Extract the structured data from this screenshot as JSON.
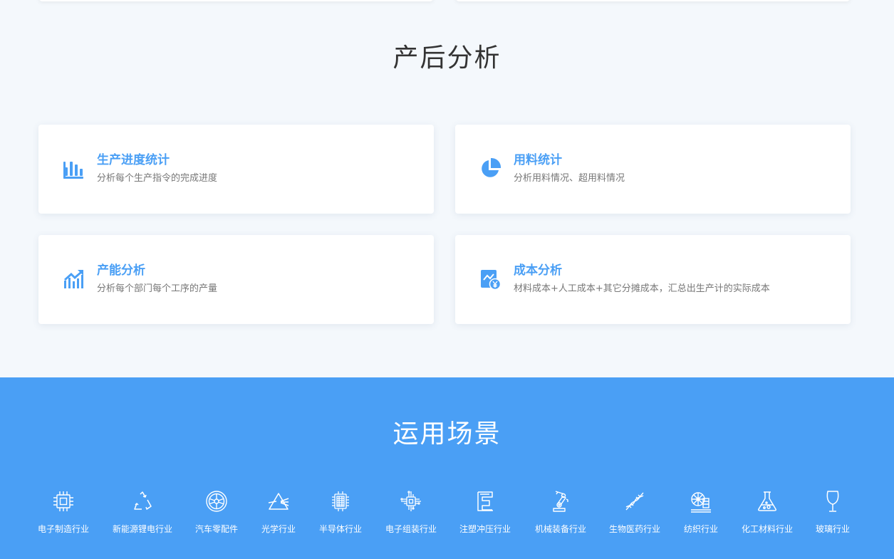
{
  "post_analysis": {
    "title": "产后分析",
    "cards": [
      {
        "title": "生产进度统计",
        "desc": "分析每个生产指令的完成进度",
        "icon": "bar-chart-icon"
      },
      {
        "title": "用料统计",
        "desc": "分析用料情况、超用料情况",
        "icon": "pie-chart-icon"
      },
      {
        "title": "产能分析",
        "desc": "分析每个部门每个工序的产量",
        "icon": "trend-chart-icon"
      },
      {
        "title": "成本分析",
        "desc": "材料成本+人工成本+其它分摊成本，汇总出生产计的实际成本",
        "icon": "cost-report-icon"
      }
    ]
  },
  "scenarios": {
    "title": "运用场景",
    "items": [
      {
        "label": "电子制造行业",
        "icon": "chip-icon"
      },
      {
        "label": "新能源锂电行业",
        "icon": "recycle-icon"
      },
      {
        "label": "汽车零配件",
        "icon": "wheel-icon"
      },
      {
        "label": "光学行业",
        "icon": "prism-icon"
      },
      {
        "label": "半导体行业",
        "icon": "semiconductor-icon"
      },
      {
        "label": "电子组装行业",
        "icon": "circuit-board-icon"
      },
      {
        "label": "注塑冲压行业",
        "icon": "stamping-icon"
      },
      {
        "label": "机械装备行业",
        "icon": "robot-arm-icon"
      },
      {
        "label": "生物医药行业",
        "icon": "dna-icon"
      },
      {
        "label": "纺织行业",
        "icon": "textile-icon"
      },
      {
        "label": "化工材料行业",
        "icon": "flask-icon"
      },
      {
        "label": "玻璃行业",
        "icon": "wine-glass-icon"
      }
    ]
  },
  "colors": {
    "accent": "#4a9ff5",
    "background": "#f4f8fc",
    "card": "#ffffff",
    "title_text": "#333333",
    "desc_text": "#777777"
  }
}
